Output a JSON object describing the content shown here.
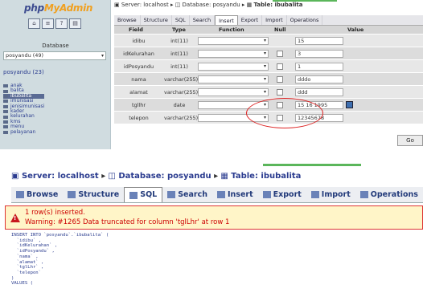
{
  "sidebar": {
    "logo_a": "php",
    "logo_b": "MyAdmin",
    "database_label": "Database",
    "database_select": "posyandu (49)",
    "database_name": "posyandu (23)",
    "tables": [
      {
        "label": "anak",
        "selected": false
      },
      {
        "label": "balita",
        "selected": false
      },
      {
        "label": "ibubalita",
        "selected": true
      },
      {
        "label": "imunisasi",
        "selected": false
      },
      {
        "label": "jenisimunisasi",
        "selected": false
      },
      {
        "label": "kader",
        "selected": false
      },
      {
        "label": "kelurahan",
        "selected": false
      },
      {
        "label": "kms",
        "selected": false
      },
      {
        "label": "menu",
        "selected": false
      },
      {
        "label": "pelayanan",
        "selected": false
      }
    ]
  },
  "top": {
    "breadcrumb": {
      "server": "Server: localhost",
      "database": "Database: posyandu",
      "table": "Table: ibubalita"
    },
    "tabs": [
      "Browse",
      "Structure",
      "SQL",
      "Search",
      "Insert",
      "Export",
      "Import",
      "Operations"
    ],
    "active_tab": "Insert",
    "headers": {
      "field": "Field",
      "type": "Type",
      "function": "Function",
      "null": "Null",
      "value": "Value"
    },
    "rows": [
      {
        "field": "idibu",
        "type": "int(11)",
        "value": "15"
      },
      {
        "field": "idKelurahan",
        "type": "int(11)",
        "value": "3"
      },
      {
        "field": "idPosyandu",
        "type": "int(11)",
        "value": "1"
      },
      {
        "field": "nama",
        "type": "varchar(255)",
        "value": "dddo"
      },
      {
        "field": "alamat",
        "type": "varchar(255)",
        "value": "ddd"
      },
      {
        "field": "tgllhr",
        "type": "date",
        "value": "15 16 1995"
      },
      {
        "field": "telepon",
        "type": "varchar(255)",
        "value": "12345678"
      }
    ],
    "go_label": "Go"
  },
  "bottom": {
    "breadcrumb": {
      "server": "Server: localhost",
      "database": "Database: posyandu",
      "table": "Table: ibubalita"
    },
    "tabs": [
      "Browse",
      "Structure",
      "SQL",
      "Search",
      "Insert",
      "Export",
      "Import",
      "Operations"
    ],
    "active_tab": "SQL",
    "notice_line1": "1 row(s) inserted.",
    "notice_line2": "Warning: #1265 Data truncated for column 'tglLhr' at row 1",
    "sql_lines": [
      "INSERT INTO `posyandu`.`ibubalita` (",
      "  `idibu` ,",
      "  `idKelurahan` ,",
      "  `idPosyandu` ,",
      "  `nama` ,",
      "  `alamat` ,",
      "  `tglLhr` ,",
      "  `telepon`",
      ")",
      "VALUES ("
    ]
  },
  "colors": {
    "sidebar_bg": "#d0dce0",
    "accent_blue": "#2a3b8f",
    "warning_red": "#c00",
    "highlight_circle": "#d22",
    "green_mark": "#5bb65b"
  }
}
